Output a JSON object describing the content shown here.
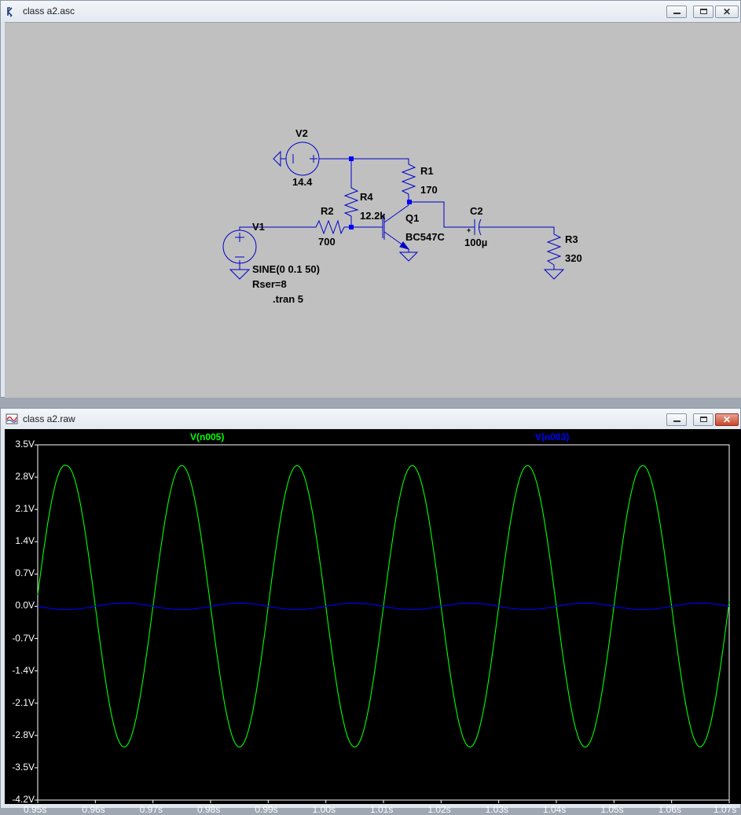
{
  "schematic_window": {
    "title": "class a2.asc",
    "components": {
      "v2": {
        "name": "V2",
        "value": "14.4"
      },
      "r1": {
        "name": "R1",
        "value": "170"
      },
      "r4": {
        "name": "R4",
        "value": "12.2k"
      },
      "r2": {
        "name": "R2",
        "value": "700"
      },
      "q1": {
        "name": "Q1",
        "value": "BC547C"
      },
      "c2": {
        "name": "C2",
        "value": "100µ"
      },
      "r3": {
        "name": "R3",
        "value": "320"
      },
      "v1": {
        "name": "V1",
        "value": "SINE(0 0.1 50)",
        "extra": "Rser=8"
      }
    },
    "directive": ".tran 5",
    "colors": {
      "background": "#c0c0c0",
      "wire": "#0000c8",
      "junction": "#0000ff",
      "text": "#000000"
    }
  },
  "plot_window": {
    "title": "class a2.raw",
    "colors": {
      "background": "#000000",
      "grid_axis": "#ffffff"
    }
  },
  "chart_data": {
    "type": "line",
    "x_unit": "s",
    "xlim": [
      0.95,
      1.07
    ],
    "ylim": [
      -4.2,
      3.5
    ],
    "x_ticks": [
      "0.95s",
      "0.96s",
      "0.97s",
      "0.98s",
      "0.99s",
      "1.00s",
      "1.01s",
      "1.02s",
      "1.03s",
      "1.04s",
      "1.05s",
      "1.06s",
      "1.07s"
    ],
    "y_ticks": [
      "3.5V",
      "2.8V",
      "2.1V",
      "1.4V",
      "0.7V",
      "0.0V",
      "-0.7V",
      "-1.4V",
      "-2.1V",
      "-2.8V",
      "-3.5V",
      "-4.2V"
    ],
    "y_tick_values": [
      3.5,
      2.8,
      2.1,
      1.4,
      0.7,
      0.0,
      -0.7,
      -1.4,
      -2.1,
      -2.8,
      -3.5,
      -4.2
    ],
    "series": [
      {
        "name": "V(n005)",
        "color": "#00ff00",
        "x": [
          0.95,
          0.955,
          0.96,
          0.965,
          0.97,
          0.975,
          0.98,
          0.985,
          0.99,
          0.995,
          1.0,
          1.005,
          1.01,
          1.015,
          1.02,
          1.025,
          1.03,
          1.035,
          1.04,
          1.045,
          1.05,
          1.055,
          1.06,
          1.065,
          1.07
        ],
        "y": [
          0.25,
          3.05,
          0.0,
          -3.05,
          0.0,
          3.05,
          0.0,
          -3.05,
          0.0,
          3.05,
          0.0,
          -3.05,
          0.0,
          3.05,
          0.0,
          -3.05,
          0.0,
          3.05,
          0.0,
          -3.05,
          0.0,
          3.05,
          0.0,
          -3.05,
          0.1
        ]
      },
      {
        "name": "V(n003)",
        "color": "#0000ff",
        "x": [
          0.95,
          0.955,
          0.96,
          0.965,
          0.97,
          0.975,
          0.98,
          0.985,
          0.99,
          0.995,
          1.0,
          1.005,
          1.01,
          1.015,
          1.02,
          1.025,
          1.03,
          1.035,
          1.04,
          1.045,
          1.05,
          1.055,
          1.06,
          1.065,
          1.07
        ],
        "y": [
          0.0,
          -0.07,
          0.0,
          0.07,
          0.0,
          -0.07,
          0.0,
          0.07,
          0.0,
          -0.07,
          0.0,
          0.07,
          0.0,
          -0.07,
          0.0,
          0.07,
          0.0,
          -0.07,
          0.0,
          0.07,
          0.0,
          -0.07,
          0.0,
          0.07,
          0.0
        ]
      }
    ]
  }
}
